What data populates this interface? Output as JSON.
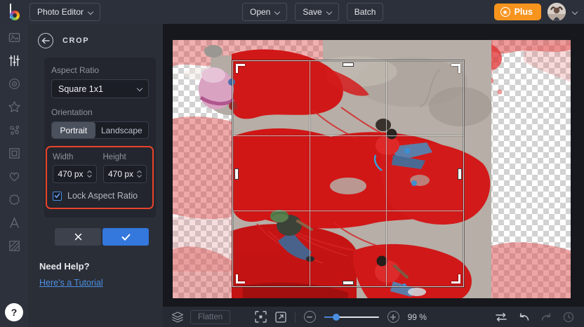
{
  "header": {
    "logo_icon": "befunky-logo",
    "app_menu_label": "Photo Editor",
    "open_label": "Open",
    "save_label": "Save",
    "batch_label": "Batch",
    "plus_label": "Plus",
    "plus_icon": "star-circle-icon",
    "avatar_icon": "user-avatar"
  },
  "sidebar": {
    "tools": [
      "photo-manager-icon",
      "edit-sliders-icon",
      "effects-eye-icon",
      "artsy-star-icon",
      "touchup-dots-icon",
      "frames-icon",
      "graphics-heart-icon",
      "overlays-badge-icon",
      "text-icon",
      "textures-icon"
    ],
    "active_tool": "edit-sliders-icon",
    "help_label": "?"
  },
  "crop_panel": {
    "title": "CROP",
    "back_icon": "back-arrow-icon",
    "aspect_ratio_label": "Aspect Ratio",
    "aspect_ratio_value": "Square 1x1",
    "orientation_label": "Orientation",
    "portrait_label": "Portrait",
    "landscape_label": "Landscape",
    "orientation_selected": "Portrait",
    "width_label": "Width",
    "width_value": "470 px",
    "height_label": "Height",
    "height_value": "470 px",
    "lock_label": "Lock Aspect Ratio",
    "lock_checked": true,
    "cancel_icon": "x-icon",
    "apply_icon": "check-icon",
    "help_heading": "Need Help?",
    "tutorial_link": "Here's a Tutorial",
    "annotation": "red-callout-box around width/height/lock controls"
  },
  "bottom_bar": {
    "layers_icon": "layers-icon",
    "flatten_label": "Flatten",
    "fit_icon": "fit-to-screen-icon",
    "fullview_icon": "open-full-view-icon",
    "zoom_out_icon": "minus-icon",
    "zoom_in_icon": "plus-icon",
    "zoom_value": "99 %",
    "compare_icon": "compare-arrows-icon",
    "undo_icon": "undo-icon",
    "redo_icon": "redo-icon",
    "history_icon": "history-clock-icon"
  },
  "colors": {
    "accent_orange": "#F7941E",
    "accent_blue": "#3477DD",
    "annotation_red": "#E8432A",
    "link_blue": "#4D8FE0",
    "topbar_bg": "#2C303A",
    "panel_bg": "#2A2E37",
    "canvas_bg": "#16181D"
  }
}
